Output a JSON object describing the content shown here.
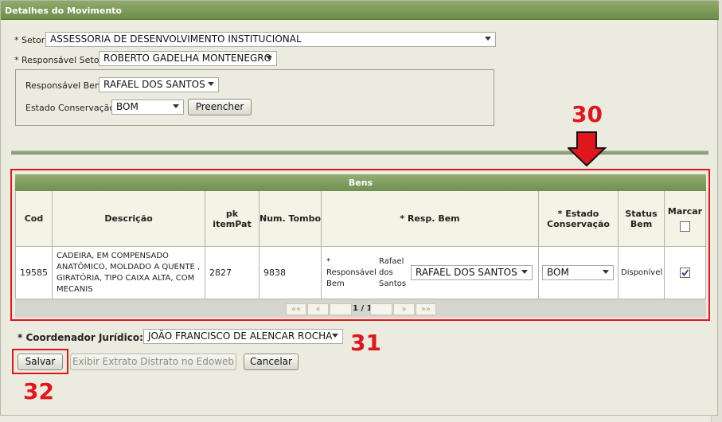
{
  "dialog": {
    "title": "Detalhes do Movimento"
  },
  "form": {
    "setor_label": "* Setor:",
    "setor_value": "ASSESSORIA DE DESENVOLVIMENTO INSTITUCIONAL",
    "resp_setor_label": "* Responsável Setor:",
    "resp_setor_value": "ROBERTO GADELHA MONTENEGRO",
    "resp_bem_label": "Responsável Bem",
    "resp_bem_value": "RAFAEL DOS SANTOS",
    "estado_label": "Estado Conservação:",
    "estado_value": "BOM",
    "preencher_label": "Preencher"
  },
  "grid": {
    "title": "Bens",
    "columns": {
      "cod": "Cod",
      "descricao": "Descrição",
      "pk": "pk itemPat",
      "tombo": "Num. Tombo",
      "resp": "* Resp. Bem",
      "estado": "* Estado Conservação",
      "status": "Status Bem",
      "marcar": "Marcar"
    },
    "rows": [
      {
        "cod": "19585",
        "descricao": "CADEIRA, EM COMPENSADO ANATÔMICO, MOLDADO A QUENTE , GIRATÓRIA, TIPO CAIXA ALTA, COM MECANIS",
        "pk": "2827",
        "tombo": "9838",
        "resp_label": "* Responsável Bem",
        "resp_name": "Rafael dos Santos",
        "resp_select": "RAFAEL DOS SANTOS",
        "estado": "BOM",
        "status": "Disponível",
        "checked": true
      }
    ],
    "pager": {
      "first": "««",
      "prev": "«",
      "page_info": "1 / 1",
      "next": "»",
      "last": "»»"
    }
  },
  "footer": {
    "coordenador_label": "* Coordenador Jurídico:",
    "coordenador_value": "JOÃO FRANCISCO DE ALENCAR ROCHA",
    "salvar": "Salvar",
    "exibir": "Exibir Extrato Distrato no Edoweb",
    "cancelar": "Cancelar"
  },
  "annotations": {
    "n30": "30",
    "n31": "31",
    "n32": "32",
    "color": "#e0161c"
  }
}
